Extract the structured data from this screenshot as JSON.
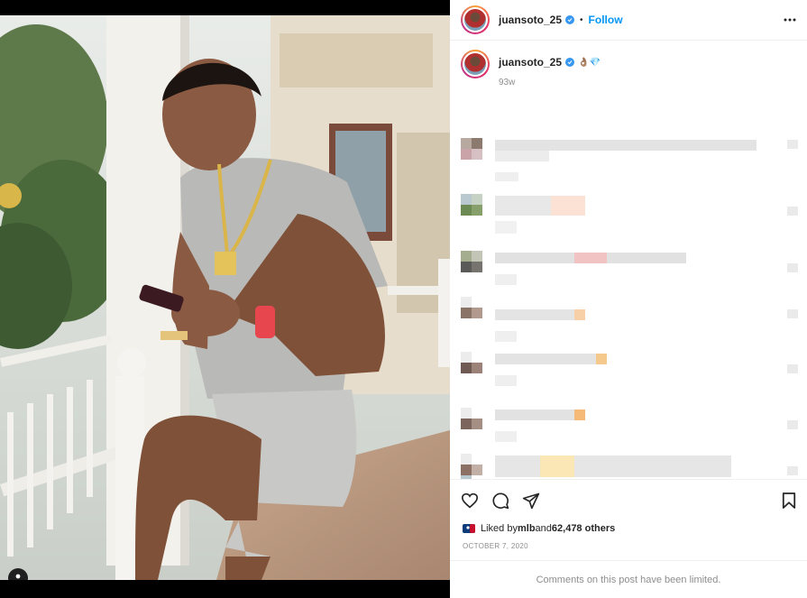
{
  "post": {
    "username": "juansoto_25",
    "follow_label": "Follow",
    "separator": "•",
    "caption_emojis": "👌🏽💎",
    "time_ago": "93w",
    "liked_by_prefix": "Liked by ",
    "liked_by_user": "mlb",
    "liked_by_middle": " and ",
    "liked_by_count": "62,478 others",
    "date": "OCTOBER 7, 2020",
    "comments_limited": "Comments on this post have been limited."
  },
  "icons": {
    "more": "more-options-icon",
    "like": "heart-icon",
    "comment": "comment-icon",
    "share": "share-icon",
    "save": "bookmark-icon",
    "tag": "user-tag-icon",
    "verified": "verified-badge-icon"
  },
  "colors": {
    "accent": "#0095f6",
    "verified": "#3897f0",
    "muted": "#8e8e8e",
    "text": "#262626"
  }
}
